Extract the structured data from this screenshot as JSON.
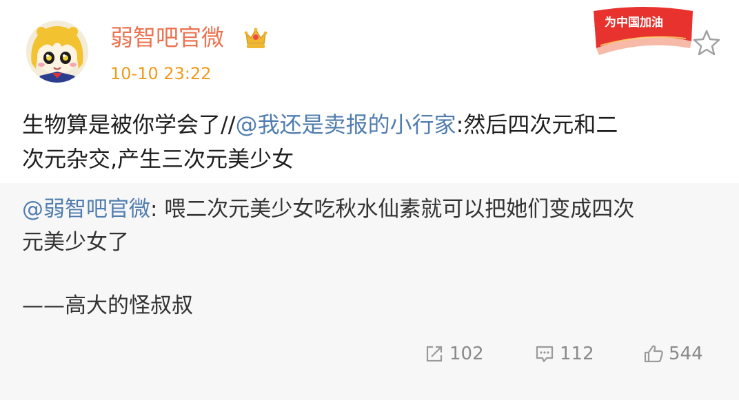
{
  "post": {
    "author": {
      "name": "弱智吧官微",
      "avatar_icon": "cartoon-girl-avatar",
      "badge_icon": "vip-crown-icon"
    },
    "timestamp": "10-10 23:22",
    "campaign_badge": {
      "label": "为中国加油",
      "color": "#e8322e"
    },
    "follow_icon": "star-icon",
    "text_line1_plain": "生物算是被你学会了//",
    "text_line1_mention": "@我还是卖报的小行家",
    "text_line1_rest": ":然后四次元和二",
    "text_line2": "次元杂交,产生三次元美少女"
  },
  "repost": {
    "mention": "@弱智吧官微",
    "line1_rest": ": 喂二次元美少女吃秋水仙素就可以把她们变成四次",
    "line2": "元美少女了",
    "signature": "——高大的怪叔叔"
  },
  "actions": {
    "repost_count": "102",
    "comment_count": "112",
    "like_count": "544"
  },
  "colors": {
    "username": "#eb7350",
    "timestamp": "#f09a1a",
    "mention": "#507daf",
    "repost_background": "#f7f7f7"
  }
}
